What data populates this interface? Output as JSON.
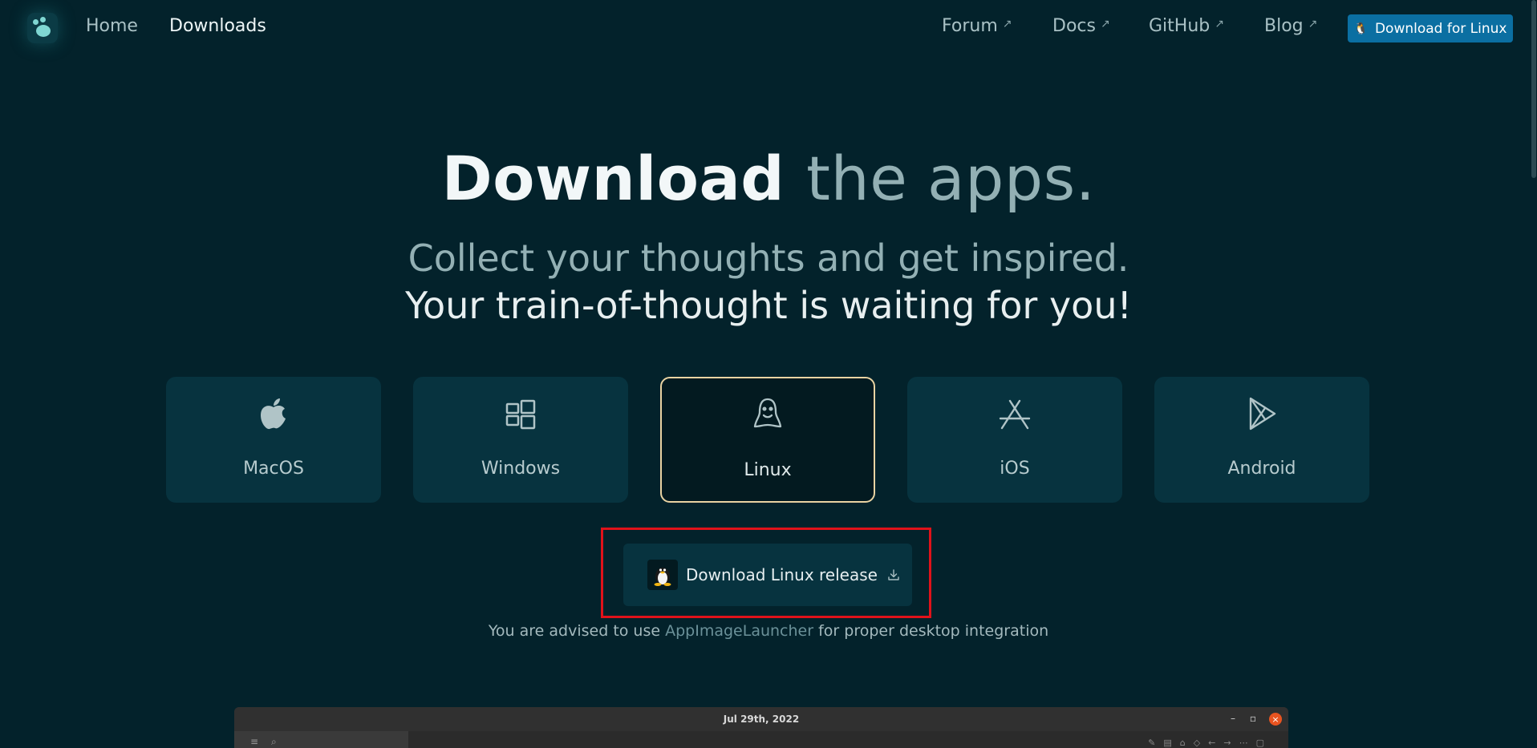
{
  "nav": {
    "home": "Home",
    "downloads": "Downloads",
    "forum": "Forum",
    "docs": "Docs",
    "github": "GitHub",
    "blog": "Blog",
    "cta": "Download for Linux"
  },
  "hero": {
    "title_strong": "Download",
    "title_light": "the apps.",
    "subtitle_1": "Collect your thoughts and get inspired.",
    "subtitle_2": "Your train-of-thought is waiting for you!"
  },
  "platforms": [
    {
      "label": "MacOS",
      "icon": "apple-icon"
    },
    {
      "label": "Windows",
      "icon": "windows-icon"
    },
    {
      "label": "Linux",
      "icon": "linux-icon",
      "selected": true
    },
    {
      "label": "iOS",
      "icon": "app-store-icon"
    },
    {
      "label": "Android",
      "icon": "play-store-icon"
    }
  ],
  "download": {
    "button_label": "Download Linux release",
    "advice_prefix": "You are advised to use",
    "advice_link": "AppImageLauncher",
    "advice_suffix": "for proper desktop integration"
  },
  "preview": {
    "window_title": "Jul 29th, 2022"
  },
  "colors": {
    "background": "#03222b",
    "card": "#07333f",
    "selected_border": "#e9d3a2",
    "cta": "#0b6fa2",
    "highlight": "#e0121a"
  }
}
